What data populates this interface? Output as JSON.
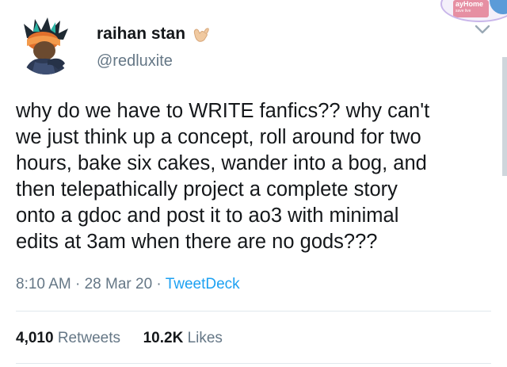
{
  "tweet": {
    "display_name": "raihan stan",
    "handle": "@redluxite",
    "text": "why do we have to WRITE fanfics?? why can't\nwe just think up a concept, roll around for two\nhours, bake six cakes, wander into a bog, and\nthen telepathically project a complete story\nonto a gdoc and post it to ao3 with minimal\nedits at 3am when there are no gods???",
    "time": "8:10 AM",
    "separator1": " · ",
    "date": "28 Mar 20",
    "separator2": " · ",
    "source": "TweetDeck"
  },
  "stats": {
    "retweets_count": "4,010",
    "retweets_label": "Retweets",
    "likes_count": "10.2K",
    "likes_label": "Likes"
  },
  "corner_badge": {
    "title": "ayHome",
    "subtitle": "save live"
  },
  "icons": {
    "name_emoji": "call-me-hand-icon",
    "menu": "chevron-down-icon"
  },
  "colors": {
    "link": "#1da1f2",
    "secondary_text": "#657786",
    "primary_text": "#14171a",
    "divider": "#e1e8ed"
  }
}
